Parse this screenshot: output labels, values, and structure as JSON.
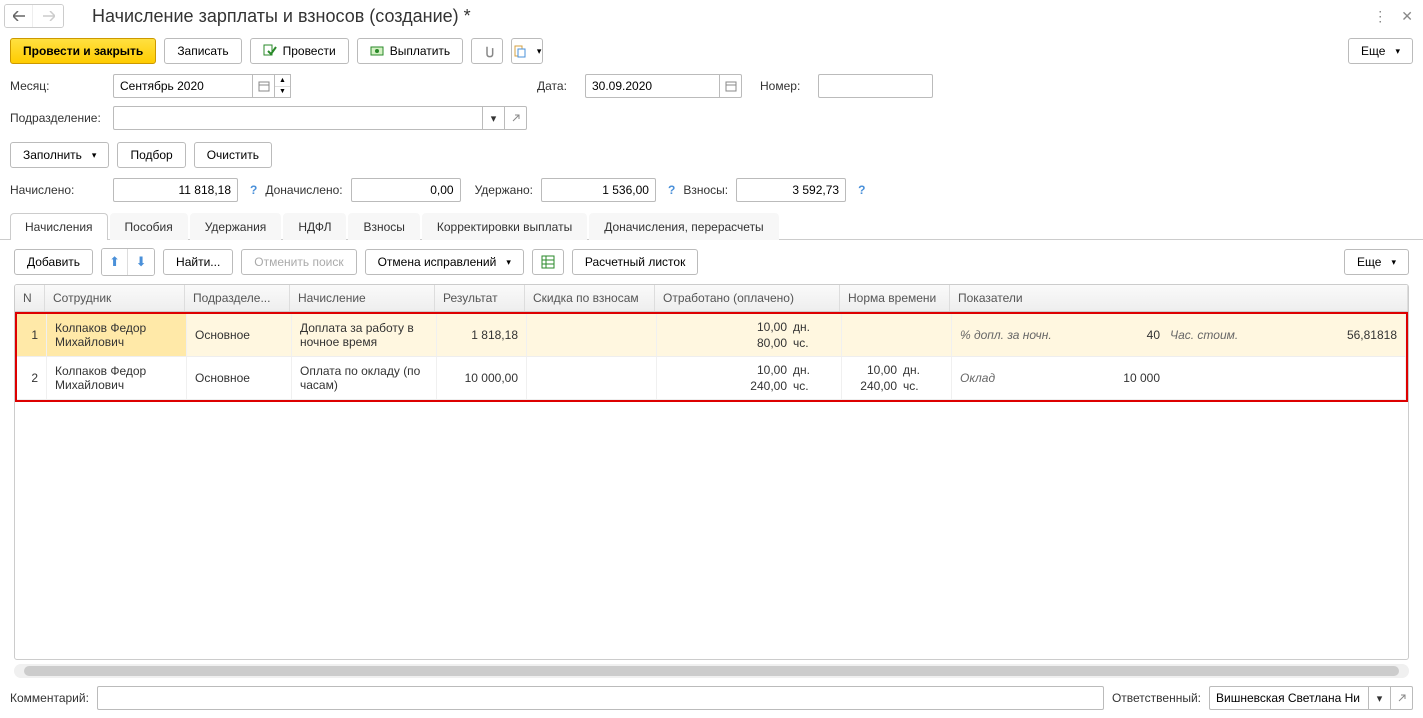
{
  "title": "Начисление зарплаты и взносов (создание) *",
  "toolbar": {
    "post_close": "Провести и закрыть",
    "save": "Записать",
    "post": "Провести",
    "payout": "Выплатить",
    "more": "Еще"
  },
  "header": {
    "month_label": "Месяц:",
    "month_value": "Сентябрь 2020",
    "date_label": "Дата:",
    "date_value": "30.09.2020",
    "number_label": "Номер:",
    "number_value": "",
    "department_label": "Подразделение:",
    "department_value": ""
  },
  "actions": {
    "fill": "Заполнить",
    "pick": "Подбор",
    "clear": "Очистить"
  },
  "totals": {
    "accrued_label": "Начислено:",
    "accrued": "11 818,18",
    "additional_label": "Доначислено:",
    "additional": "0,00",
    "withheld_label": "Удержано:",
    "withheld": "1 536,00",
    "contrib_label": "Взносы:",
    "contrib": "3 592,73"
  },
  "tabs": [
    "Начисления",
    "Пособия",
    "Удержания",
    "НДФЛ",
    "Взносы",
    "Корректировки выплаты",
    "Доначисления, перерасчеты"
  ],
  "tab_toolbar": {
    "add": "Добавить",
    "find": "Найти...",
    "cancel_search": "Отменить поиск",
    "cancel_fix": "Отмена исправлений",
    "payslip": "Расчетный листок",
    "more": "Еще"
  },
  "columns": {
    "n": "N",
    "employee": "Сотрудник",
    "department": "Подразделе...",
    "accrual": "Начисление",
    "result": "Результат",
    "discount": "Скидка по взносам",
    "worked": "Отработано (оплачено)",
    "norm": "Норма времени",
    "indicators": "Показатели"
  },
  "rows": [
    {
      "n": "1",
      "employee": "Колпаков Федор Михайлович",
      "department": "Основное",
      "accrual": "Доплата за работу в ночное время",
      "result": "1 818,18",
      "worked_days": "10,00",
      "worked_days_u": "дн.",
      "worked_hours": "80,00",
      "worked_hours_u": "чс.",
      "norm_days": "",
      "norm_days_u": "",
      "norm_hours": "",
      "norm_hours_u": "",
      "ind1_name": "% допл. за ночн.",
      "ind1_val": "40",
      "ind2_name": "Час. стоим.",
      "ind2_val": "56,81818"
    },
    {
      "n": "2",
      "employee": "Колпаков Федор Михайлович",
      "department": "Основное",
      "accrual": "Оплата по окладу (по часам)",
      "result": "10 000,00",
      "worked_days": "10,00",
      "worked_days_u": "дн.",
      "worked_hours": "240,00",
      "worked_hours_u": "чс.",
      "norm_days": "10,00",
      "norm_days_u": "дн.",
      "norm_hours": "240,00",
      "norm_hours_u": "чс.",
      "ind1_name": "Оклад",
      "ind1_val": "10 000",
      "ind2_name": "",
      "ind2_val": ""
    }
  ],
  "footer": {
    "comment_label": "Комментарий:",
    "comment_value": "",
    "responsible_label": "Ответственный:",
    "responsible_value": "Вишневская Светлана Ни"
  }
}
